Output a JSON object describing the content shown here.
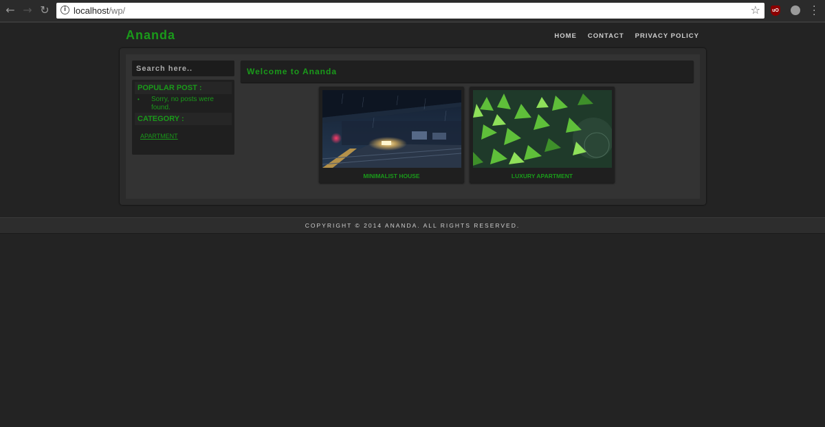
{
  "browser": {
    "url_host": "localhost",
    "url_path": "/wp/"
  },
  "site": {
    "title": "Ananda",
    "nav": [
      "HOME",
      "CONTACT",
      "PRIVACY POLICY"
    ]
  },
  "sidebar": {
    "search_placeholder": "Search here..",
    "popular_heading": "POPULAR POST :",
    "popular_empty": "Sorry, no posts were found.",
    "category_heading": "CATEGORY :",
    "categories": [
      "APARTMENT"
    ]
  },
  "main": {
    "welcome": "Welcome to Ananda",
    "posts": [
      {
        "caption": "MINIMALIST HOUSE",
        "image": "night-train-station"
      },
      {
        "caption": "LUXURY APARTMENT",
        "image": "green-maple-leaves"
      }
    ]
  },
  "footer": {
    "copyright": "COPYRIGHT © 2014 ANANDA. ALL RIGHTS RESERVED."
  },
  "colors": {
    "accent_green": "#1a9a1a",
    "background": "#232323"
  }
}
